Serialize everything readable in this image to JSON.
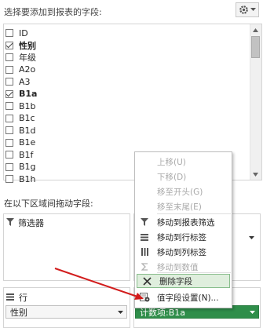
{
  "header": {
    "title": "选择要添加到报表的字段:",
    "settings_icon": "gear-icon",
    "dropdown_icon": "caret-down-icon"
  },
  "fields": [
    {
      "label": "ID",
      "checked": false,
      "bold": false
    },
    {
      "label": "性别",
      "checked": true,
      "bold": true
    },
    {
      "label": "年级",
      "checked": false,
      "bold": false
    },
    {
      "label": "A2o",
      "checked": false,
      "bold": false
    },
    {
      "label": "A3",
      "checked": false,
      "bold": false
    },
    {
      "label": "B1a",
      "checked": true,
      "bold": true
    },
    {
      "label": "B1b",
      "checked": false,
      "bold": false
    },
    {
      "label": "B1c",
      "checked": false,
      "bold": false
    },
    {
      "label": "B1d",
      "checked": false,
      "bold": false
    },
    {
      "label": "B1e",
      "checked": false,
      "bold": false
    },
    {
      "label": "B1f",
      "checked": false,
      "bold": false
    },
    {
      "label": "B1g",
      "checked": false,
      "bold": false
    },
    {
      "label": "B1h",
      "checked": false,
      "bold": false
    }
  ],
  "areas": {
    "hint": "在以下区域间拖动字段:",
    "filters_label": "筛选器",
    "filter_icon": "funnel-icon",
    "rows_label": "行",
    "rows_icon": "rows-icon",
    "row_field": "性别",
    "value_field": "计数项:B1a"
  },
  "context_menu": {
    "items": [
      {
        "label": "上移(U)",
        "enabled": false,
        "icon": ""
      },
      {
        "label": "下移(D)",
        "enabled": false,
        "icon": ""
      },
      {
        "label": "移至开头(G)",
        "enabled": false,
        "icon": ""
      },
      {
        "label": "移至末尾(E)",
        "enabled": false,
        "icon": ""
      },
      {
        "label": "移动到报表筛选",
        "enabled": true,
        "icon": "funnel-icon"
      },
      {
        "label": "移动到行标签",
        "enabled": true,
        "icon": "rows-icon"
      },
      {
        "label": "移动到列标签",
        "enabled": true,
        "icon": "columns-icon"
      },
      {
        "label": "移动到数值",
        "enabled": false,
        "icon": "sigma-icon"
      },
      {
        "label": "删除字段",
        "enabled": true,
        "highlighted": true,
        "icon": "delete-x-icon"
      },
      {
        "label": "值字段设置(N)...",
        "enabled": true,
        "icon": "value-settings-icon"
      }
    ]
  },
  "colors": {
    "value_pill": "#2f8e4a",
    "menu_highlight": "#dfeedd",
    "annotation_arrow": "#d21d1d"
  }
}
